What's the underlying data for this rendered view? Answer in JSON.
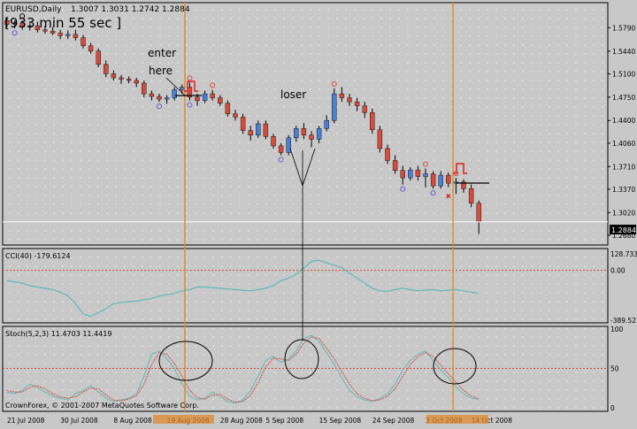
{
  "title": "EURUSD,Daily",
  "ohlc_text": "1.3007 1.3031 1.2742 1.2884",
  "timer": "[933 min 55 sec ]",
  "copyright": "CrownForex, © 2001-2007 MetaQuotes Software Corp.",
  "annotations": {
    "enter": "enter",
    "here": "here",
    "loser": "loser"
  },
  "current_price_label": "1.2884",
  "colors": {
    "bull": "#4a7fd6",
    "bear": "#d44c3c",
    "cci": "#5fb8b8",
    "stoch_main": "#5fb8b8",
    "stoch_signal": "#d44c3c",
    "vline": "#e08a2e",
    "background": "#c8c8c8"
  },
  "chart_data": [
    {
      "type": "candlestick",
      "name": "price",
      "ylim": [
        1.26,
        1.61
      ],
      "y_ticks": [
        "1.5790",
        "1.5440",
        "1.5100",
        "1.4750",
        "1.4400",
        "1.4060",
        "1.3710",
        "1.3370",
        "1.3020",
        "1.2680"
      ],
      "x_ticks": [
        "21 Jul 2008",
        "30 Jul 2008",
        "8 Aug 2008",
        "19 Aug 2008",
        "28 Aug 2008",
        "5 Sep 2008",
        "15 Sep 2008",
        "24 Sep 2008",
        "3 Oct 2008",
        "14 Oct 2008"
      ],
      "candles": [
        [
          1.59,
          1.594,
          1.58,
          1.584
        ],
        [
          1.584,
          1.59,
          1.578,
          1.586
        ],
        [
          1.586,
          1.59,
          1.576,
          1.58
        ],
        [
          1.58,
          1.586,
          1.575,
          1.582
        ],
        [
          1.582,
          1.588,
          1.572,
          1.576
        ],
        [
          1.576,
          1.582,
          1.57,
          1.574
        ],
        [
          1.574,
          1.58,
          1.568,
          1.571
        ],
        [
          1.571,
          1.576,
          1.562,
          1.567
        ],
        [
          1.567,
          1.575,
          1.562,
          1.569
        ],
        [
          1.569,
          1.576,
          1.56,
          1.564
        ],
        [
          1.564,
          1.568,
          1.548,
          1.552
        ],
        [
          1.552,
          1.556,
          1.54,
          1.544
        ],
        [
          1.544,
          1.548,
          1.52,
          1.524
        ],
        [
          1.524,
          1.53,
          1.505,
          1.51
        ],
        [
          1.51,
          1.515,
          1.5,
          1.504
        ],
        [
          1.504,
          1.508,
          1.495,
          1.502
        ],
        [
          1.502,
          1.506,
          1.496,
          1.5
        ],
        [
          1.5,
          1.504,
          1.49,
          1.496
        ],
        [
          1.496,
          1.5,
          1.475,
          1.48
        ],
        [
          1.48,
          1.485,
          1.47,
          1.476
        ],
        [
          1.476,
          1.48,
          1.468,
          1.472
        ],
        [
          1.472,
          1.478,
          1.465,
          1.474
        ],
        [
          1.474,
          1.49,
          1.47,
          1.486
        ],
        [
          1.486,
          1.494,
          1.48,
          1.49
        ],
        [
          1.49,
          1.497,
          1.47,
          1.475
        ],
        [
          1.475,
          1.48,
          1.462,
          1.47
        ],
        [
          1.47,
          1.485,
          1.466,
          1.48
        ],
        [
          1.48,
          1.486,
          1.47,
          1.474
        ],
        [
          1.474,
          1.478,
          1.462,
          1.466
        ],
        [
          1.466,
          1.47,
          1.446,
          1.45
        ],
        [
          1.45,
          1.456,
          1.44,
          1.445
        ],
        [
          1.445,
          1.45,
          1.42,
          1.425
        ],
        [
          1.425,
          1.432,
          1.41,
          1.418
        ],
        [
          1.418,
          1.44,
          1.414,
          1.435
        ],
        [
          1.435,
          1.44,
          1.412,
          1.416
        ],
        [
          1.416,
          1.42,
          1.398,
          1.402
        ],
        [
          1.402,
          1.406,
          1.388,
          1.392
        ],
        [
          1.392,
          1.418,
          1.388,
          1.414
        ],
        [
          1.414,
          1.432,
          1.408,
          1.428
        ],
        [
          1.428,
          1.436,
          1.412,
          1.418
        ],
        [
          1.418,
          1.424,
          1.4,
          1.412
        ],
        [
          1.412,
          1.432,
          1.406,
          1.428
        ],
        [
          1.428,
          1.448,
          1.424,
          1.44
        ],
        [
          1.44,
          1.488,
          1.436,
          1.48
        ],
        [
          1.48,
          1.49,
          1.468,
          1.474
        ],
        [
          1.474,
          1.48,
          1.462,
          1.468
        ],
        [
          1.468,
          1.474,
          1.454,
          1.462
        ],
        [
          1.462,
          1.468,
          1.444,
          1.452
        ],
        [
          1.452,
          1.458,
          1.42,
          1.426
        ],
        [
          1.426,
          1.432,
          1.392,
          1.398
        ],
        [
          1.398,
          1.404,
          1.375,
          1.38
        ],
        [
          1.38,
          1.388,
          1.36,
          1.365
        ],
        [
          1.365,
          1.372,
          1.344,
          1.354
        ],
        [
          1.354,
          1.37,
          1.35,
          1.366
        ],
        [
          1.366,
          1.372,
          1.35,
          1.356
        ],
        [
          1.356,
          1.368,
          1.34,
          1.36
        ],
        [
          1.36,
          1.364,
          1.338,
          1.342
        ],
        [
          1.342,
          1.364,
          1.338,
          1.358
        ],
        [
          1.358,
          1.362,
          1.34,
          1.346
        ],
        [
          1.346,
          1.354,
          1.33,
          1.348
        ],
        [
          1.348,
          1.352,
          1.332,
          1.338
        ],
        [
          1.338,
          1.344,
          1.31,
          1.316
        ],
        [
          1.316,
          1.32,
          1.27,
          1.288
        ]
      ]
    },
    {
      "type": "line",
      "name": "CCI(40)",
      "label": "CCI(40) -179.6124",
      "ylim": [
        -389.5,
        150
      ],
      "y_ticks": [
        "128.7333",
        "0.00",
        "-389.5234"
      ],
      "reference_level": 0,
      "values": [
        -80,
        -90,
        -100,
        -120,
        -130,
        -140,
        -150,
        -170,
        -200,
        -260,
        -340,
        -360,
        -330,
        -300,
        -260,
        -250,
        -245,
        -240,
        -230,
        -220,
        -200,
        -190,
        -180,
        -160,
        -150,
        -130,
        -130,
        -135,
        -140,
        -145,
        -150,
        -155,
        -160,
        -150,
        -140,
        -120,
        -80,
        -60,
        -30,
        20,
        70,
        80,
        60,
        40,
        20,
        -20,
        -60,
        -100,
        -140,
        -160,
        -165,
        -150,
        -140,
        -150,
        -160,
        -155,
        -150,
        -160,
        -155,
        -150,
        -160,
        -170,
        -180
      ]
    },
    {
      "type": "line",
      "name": "Stoch(5,2,3)",
      "label": "Stoch(5,2,3) 11.4703 11.4419",
      "ylim": [
        0,
        100
      ],
      "y_ticks": [
        "100",
        "50",
        "0"
      ],
      "reference_level": 50,
      "series": [
        {
          "name": "main",
          "values": [
            20,
            18,
            22,
            30,
            26,
            20,
            15,
            12,
            10,
            18,
            22,
            28,
            20,
            12,
            8,
            10,
            12,
            18,
            40,
            68,
            72,
            62,
            50,
            30,
            15,
            10,
            12,
            20,
            14,
            8,
            6,
            10,
            22,
            40,
            60,
            65,
            58,
            62,
            72,
            88,
            92,
            84,
            70,
            55,
            38,
            22,
            14,
            10,
            8,
            12,
            18,
            30,
            48,
            60,
            68,
            72,
            60,
            48,
            38,
            26,
            18,
            12,
            11
          ]
        },
        {
          "name": "signal",
          "values": [
            22,
            20,
            20,
            26,
            28,
            24,
            18,
            14,
            12,
            14,
            20,
            25,
            24,
            16,
            10,
            9,
            11,
            15,
            30,
            55,
            70,
            68,
            56,
            40,
            22,
            13,
            11,
            16,
            17,
            11,
            7,
            8,
            16,
            32,
            52,
            63,
            62,
            60,
            68,
            82,
            90,
            88,
            76,
            62,
            46,
            30,
            18,
            12,
            9,
            10,
            15,
            24,
            40,
            55,
            65,
            70,
            65,
            54,
            43,
            32,
            22,
            15,
            11
          ]
        }
      ]
    }
  ]
}
